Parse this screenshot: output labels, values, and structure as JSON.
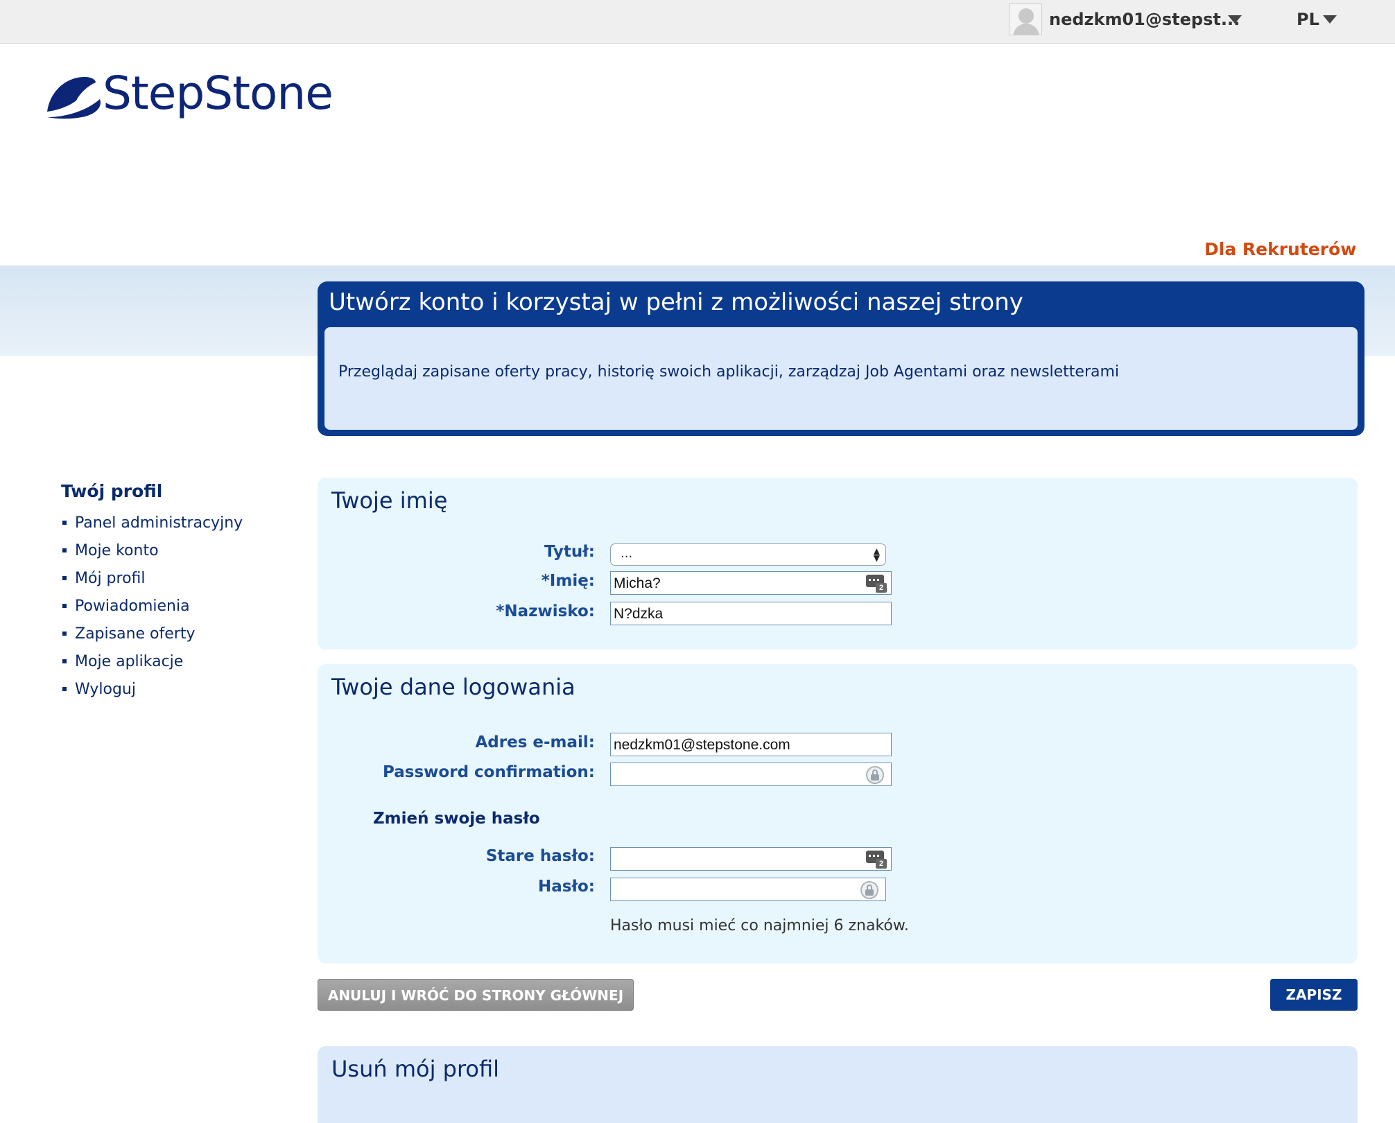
{
  "topbar": {
    "user_email": "nedzkm01@stepst...",
    "language": "PL"
  },
  "brand": {
    "logo_text": "StepStone",
    "accent": "#0a3b8f",
    "recruiters_color": "#d24a10"
  },
  "header": {
    "recruiters_link": "Dla Rekruterów"
  },
  "hero": {
    "title": "Utwórz konto i korzystaj w pełni z możliwości naszej strony",
    "text": "Przeglądaj zapisane oferty pracy, historię swoich aplikacji, zarządzaj Job Agentami oraz newsletterami"
  },
  "sidebar": {
    "title": "Twój profil",
    "items": [
      {
        "label": "Panel administracyjny"
      },
      {
        "label": "Moje konto"
      },
      {
        "label": "Mój profil"
      },
      {
        "label": "Powiadomienia"
      },
      {
        "label": "Zapisane oferty"
      },
      {
        "label": "Moje aplikacje"
      },
      {
        "label": "Wyloguj"
      }
    ]
  },
  "name_section": {
    "title": "Twoje imię",
    "title_label": "Tytuł:",
    "title_value": "...",
    "first_name_label": "*Imię:",
    "first_name_value": "Micha?",
    "last_name_label": "*Nazwisko:",
    "last_name_value": "N?dzka"
  },
  "login_section": {
    "title": "Twoje dane logowania",
    "email_label": "Adres e-mail:",
    "email_value": "nedzkm01@stepstone.com",
    "password_confirm_label": "Password confirmation:",
    "change_password_heading": "Zmień swoje hasło",
    "old_password_label": "Stare hasło:",
    "password_label": "Hasło:",
    "password_hint": "Hasło musi mieć co najmniej 6 znaków."
  },
  "actions": {
    "cancel_label": "ANULUJ I WRÓĆ DO STRONY GŁÓWNEJ",
    "save_label": "ZAPISZ"
  },
  "delete_section": {
    "title": "Usuń mój profil"
  },
  "icons": {
    "avatar": "user-avatar-icon",
    "dropdown": "caret-down-icon",
    "password_manager": "keyboard-icon",
    "lock": "lock-icon"
  }
}
